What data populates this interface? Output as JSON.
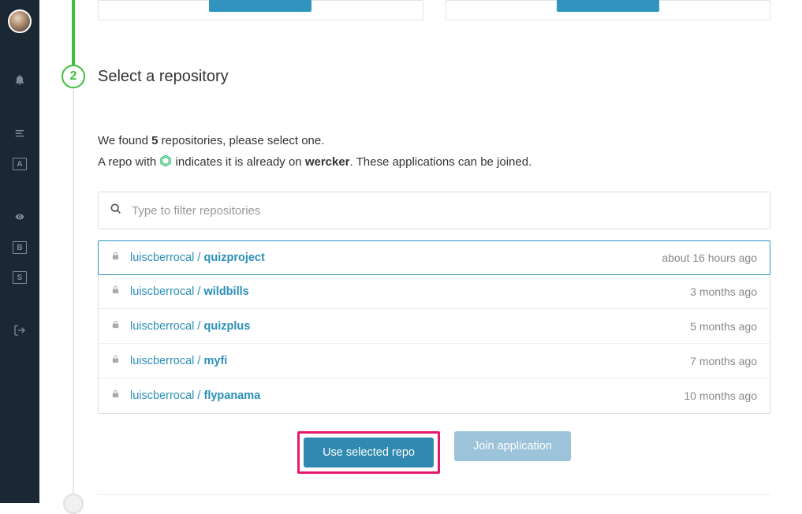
{
  "sidebar": {
    "letters": [
      "A",
      "B",
      "S"
    ]
  },
  "step": {
    "number": "2",
    "title": "Select a repository"
  },
  "intro": {
    "prefix": "We found ",
    "count": "5",
    "suffix": " repositories, please select one.",
    "line2_a": "A repo with ",
    "line2_b": " indicates it is already on ",
    "brand": "wercker",
    "line2_c": ". These applications can be joined."
  },
  "filter": {
    "placeholder": "Type to filter repositories"
  },
  "repos": [
    {
      "owner": "luiscberrocal",
      "name": "quizproject",
      "time": "about 16 hours ago",
      "selected": true
    },
    {
      "owner": "luiscberrocal",
      "name": "wildbills",
      "time": "3 months ago",
      "selected": false
    },
    {
      "owner": "luiscberrocal",
      "name": "quizplus",
      "time": "5 months ago",
      "selected": false
    },
    {
      "owner": "luiscberrocal",
      "name": "myfi",
      "time": "7 months ago",
      "selected": false
    },
    {
      "owner": "luiscberrocal",
      "name": "flypanama",
      "time": "10 months ago",
      "selected": false
    }
  ],
  "actions": {
    "primary": "Use selected repo",
    "secondary": "Join application"
  }
}
